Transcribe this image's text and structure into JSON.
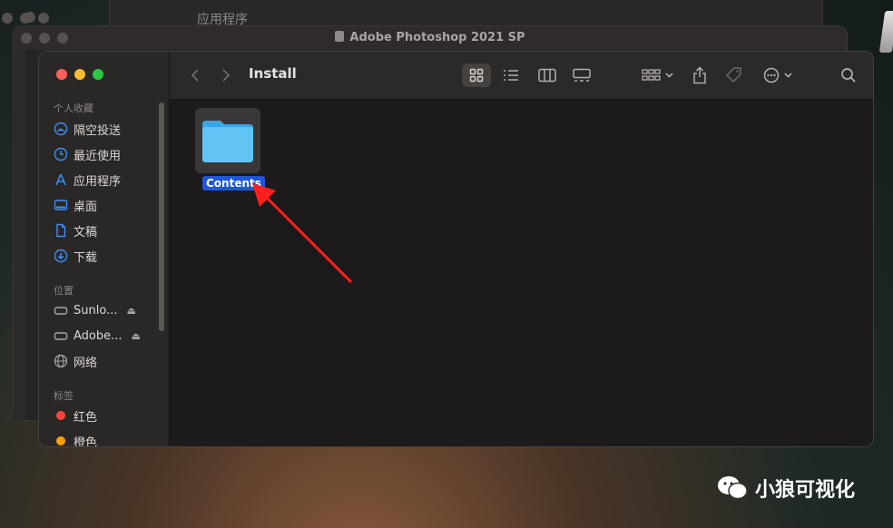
{
  "back_window_1": {
    "title": "应用程序"
  },
  "back_window_2": {
    "title": "Adobe Photoshop 2021 SP"
  },
  "finder": {
    "current_folder": "Install",
    "sidebar": {
      "favorites_header": "个人收藏",
      "favorites": [
        {
          "label": "隔空投送",
          "icon": "airdrop-icon"
        },
        {
          "label": "最近使用",
          "icon": "clock-icon"
        },
        {
          "label": "应用程序",
          "icon": "apps-icon"
        },
        {
          "label": "桌面",
          "icon": "desktop-icon"
        },
        {
          "label": "文稿",
          "icon": "document-icon"
        },
        {
          "label": "下载",
          "icon": "download-icon"
        }
      ],
      "locations_header": "位置",
      "locations": [
        {
          "label": "Sunlo...",
          "icon": "disk-icon"
        },
        {
          "label": "Adobe...",
          "icon": "disk-icon"
        },
        {
          "label": "网络",
          "icon": "globe-icon"
        }
      ],
      "tags_header": "标签",
      "tags": [
        {
          "label": "红色",
          "color": "#ff453a"
        },
        {
          "label": "橙色",
          "color": "#ff9f0a"
        }
      ]
    },
    "files": [
      {
        "name": "Contents",
        "type": "folder",
        "selected": true
      }
    ]
  },
  "watermark": {
    "text": "小狼可视化"
  },
  "colors": {
    "accent": "#1f57d6",
    "folder": "#62c4f5",
    "annotation_arrow": "#ff1f1f"
  }
}
